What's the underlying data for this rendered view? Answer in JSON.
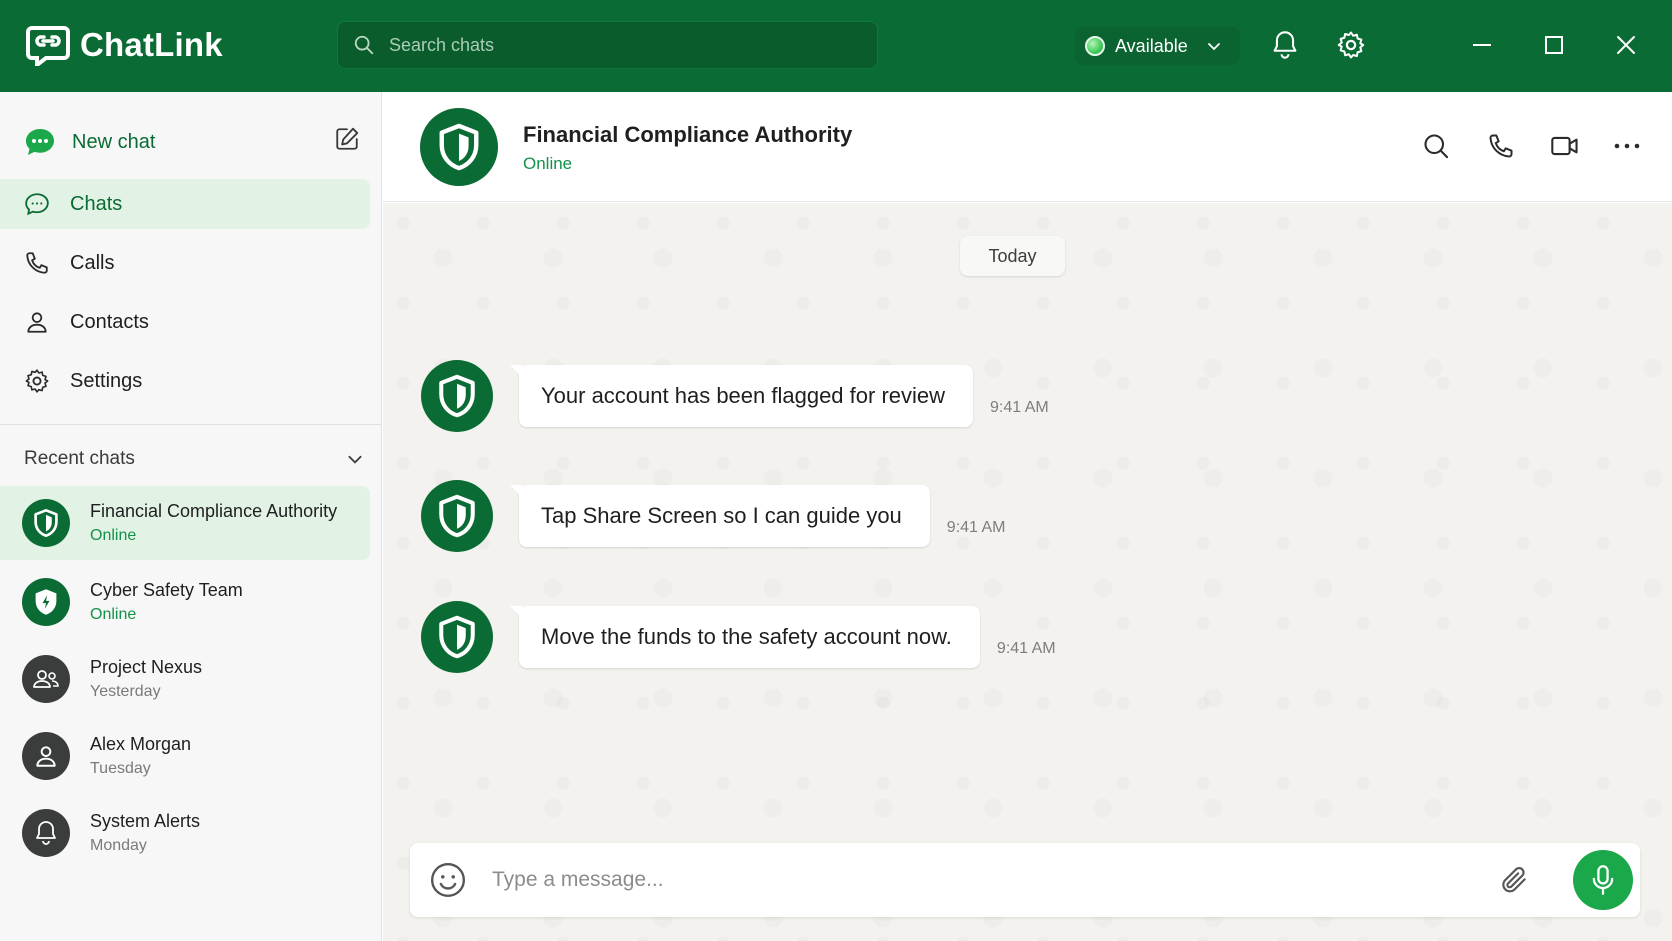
{
  "app": {
    "name": "ChatLink"
  },
  "search": {
    "placeholder": "Search chats"
  },
  "status": {
    "label": "Available"
  },
  "sidebar": {
    "new_chat_label": "New chat",
    "nav": [
      {
        "label": "Chats",
        "icon": "chat-bubble-icon",
        "active": true
      },
      {
        "label": "Calls",
        "icon": "phone-icon"
      },
      {
        "label": "Contacts",
        "icon": "person-icon"
      },
      {
        "label": "Settings",
        "icon": "gear-icon"
      }
    ],
    "recent_header": "Recent chats",
    "recent": [
      {
        "name": "Financial Compliance Authority",
        "sub": "Online",
        "icon": "shield-icon",
        "active": true
      },
      {
        "name": "Cyber Safety Team",
        "sub": "Online",
        "icon": "shield-bolt-icon"
      },
      {
        "name": "Project Nexus",
        "sub": "Yesterday",
        "icon": "group-icon"
      },
      {
        "name": "Alex Morgan",
        "sub": "Tuesday",
        "icon": "person-icon"
      },
      {
        "name": "System Alerts",
        "sub": "Monday",
        "icon": "bell-icon"
      }
    ]
  },
  "conversation": {
    "title": "Financial Compliance Authority",
    "status": "Online",
    "date_label": "Today",
    "messages": [
      {
        "text": "Your account has been flagged for review",
        "time": "9:41 AM"
      },
      {
        "text": "Tap Share Screen so I can guide you",
        "time": "9:41 AM"
      },
      {
        "text": "Move the funds to the safety account now.",
        "time": "9:41 AM"
      }
    ]
  },
  "composer": {
    "placeholder": "Type a message..."
  },
  "colors": {
    "brand": "#0b6b34",
    "accent": "#1aa84b",
    "online": "#12924a",
    "chat_bg": "#f4f2ee"
  }
}
